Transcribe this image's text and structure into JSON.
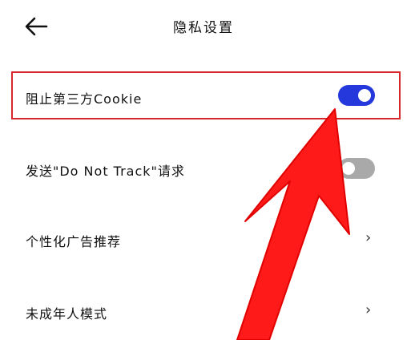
{
  "header": {
    "title": "隐私设置",
    "back_icon": "arrow-left-icon"
  },
  "settings": [
    {
      "label": "阻止第三方Cookie",
      "control": "toggle",
      "on": true
    },
    {
      "label": "发送\"Do Not Track\"请求",
      "control": "toggle",
      "on": false
    },
    {
      "label": "个性化广告推荐",
      "control": "chevron",
      "chevron": "›"
    },
    {
      "label": "未成年人模式",
      "control": "chevron",
      "chevron": "›"
    }
  ],
  "colors": {
    "toggle_on": "#2438dc",
    "toggle_off": "#a9a9a9",
    "highlight": "#d8282c",
    "annotation_arrow": "#ff1a1a"
  },
  "annotation": {
    "icon": "red-arrow-icon"
  }
}
